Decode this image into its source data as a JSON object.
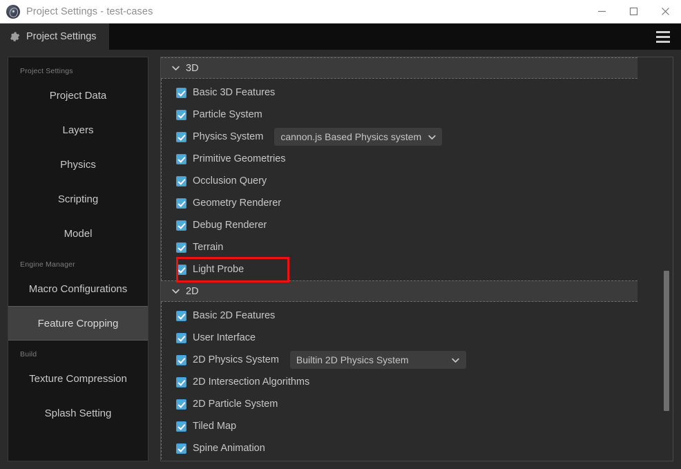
{
  "window": {
    "title": "Project Settings - test-cases",
    "logo_icon": "cocos-logo-icon",
    "controls": [
      {
        "name": "minimize-button",
        "icon": "minimize-icon"
      },
      {
        "name": "maximize-button",
        "icon": "maximize-icon"
      },
      {
        "name": "close-button",
        "icon": "close-icon"
      }
    ]
  },
  "tabbar": {
    "tab_label": "Project Settings",
    "tab_icon": "gear-icon",
    "menu_icon": "hamburger-menu-icon"
  },
  "sidebar": {
    "groups": [
      {
        "label": "Project Settings",
        "items": [
          {
            "label": "Project Data",
            "selected": false
          },
          {
            "label": "Layers",
            "selected": false
          },
          {
            "label": "Physics",
            "selected": false
          },
          {
            "label": "Scripting",
            "selected": false
          },
          {
            "label": "Model",
            "selected": false
          }
        ]
      },
      {
        "label": "Engine Manager",
        "items": [
          {
            "label": "Macro Configurations",
            "selected": false
          },
          {
            "label": "Feature Cropping",
            "selected": true
          }
        ]
      },
      {
        "label": "Build",
        "items": [
          {
            "label": "Texture Compression",
            "selected": false
          },
          {
            "label": "Splash Setting",
            "selected": false
          }
        ]
      }
    ]
  },
  "content": {
    "sections": [
      {
        "title": "3D",
        "expanded": true,
        "collapse_icon": "chevron-down-icon",
        "rows": [
          {
            "label": "Basic 3D Features",
            "checked": true
          },
          {
            "label": "Particle System",
            "checked": true
          },
          {
            "label": "Physics System",
            "checked": true,
            "dropdown": {
              "value": "cannon.js Based Physics system",
              "icon": "chevron-down-icon",
              "width": "snug"
            }
          },
          {
            "label": "Primitive Geometries",
            "checked": true
          },
          {
            "label": "Occlusion Query",
            "checked": true
          },
          {
            "label": "Geometry Renderer",
            "checked": true,
            "highlighted": true
          },
          {
            "label": "Debug Renderer",
            "checked": true
          },
          {
            "label": "Terrain",
            "checked": true
          },
          {
            "label": "Light Probe",
            "checked": true
          }
        ]
      },
      {
        "title": "2D",
        "expanded": true,
        "collapse_icon": "chevron-down-icon",
        "rows": [
          {
            "label": "Basic 2D Features",
            "checked": true
          },
          {
            "label": "User Interface",
            "checked": true
          },
          {
            "label": "2D Physics System",
            "checked": true,
            "dropdown": {
              "value": "Builtin 2D Physics System",
              "icon": "chevron-down-icon",
              "width": "wide"
            }
          },
          {
            "label": "2D Intersection Algorithms",
            "checked": true
          },
          {
            "label": "2D Particle System",
            "checked": true
          },
          {
            "label": "Tiled Map",
            "checked": true
          },
          {
            "label": "Spine Animation",
            "checked": true
          }
        ]
      }
    ],
    "highlight": {
      "target_label": "Debug Renderer",
      "color": "#ee1111"
    }
  },
  "colors": {
    "accent_checkbox": "#4fa9d8",
    "panel_bg": "#2b2b2b",
    "sidebar_bg": "#161616",
    "selected_bg": "#414141",
    "highlight_red": "#ee1111"
  }
}
